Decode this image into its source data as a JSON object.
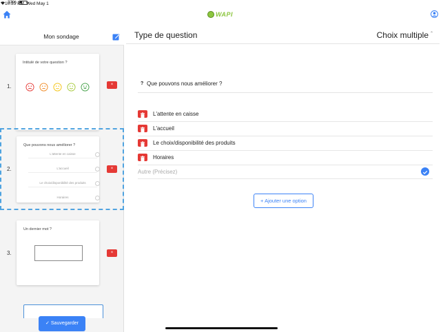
{
  "status_bar": {
    "time": "10:35 PM",
    "date": "Wed May 1",
    "battery_pct": "33%",
    "battery_fill": 0.33
  },
  "nav": {
    "logo_text": "WAPI"
  },
  "sidebar": {
    "title": "Mon sondage",
    "questions": [
      {
        "number": "1.",
        "label": "Intitulé de votre question ?",
        "type": "smiley"
      },
      {
        "number": "2.",
        "label": "Que pouvons nous améliorer ?",
        "type": "choice",
        "options": [
          "L'attente en caisse",
          "L'accueil",
          "Le choix/disponibilité des produits",
          "Horaires"
        ]
      },
      {
        "number": "3.",
        "label": "Un dernier mot ?",
        "type": "text"
      }
    ],
    "delete_label": "×",
    "save_label": "Sauvegarder"
  },
  "main": {
    "title": "Type de question",
    "type_value": "Choix multiple",
    "question_marker": "?",
    "question_text": "Que pouvons nous améliorer ?",
    "options": [
      "L'attente en caisse",
      "L'accueil",
      "Le choix/disponibilité des produits",
      "Horaires"
    ],
    "other_placeholder": "Autre (Précisez)",
    "add_option_label": "+ Ajouter une option"
  },
  "colors": {
    "accent": "#3b82f6",
    "danger": "#e53935",
    "dashed_selection": "#4fa3e0",
    "logo_green": "#8cc63f"
  },
  "icons": [
    "home-icon",
    "user-icon",
    "edit-icon",
    "trash-icon",
    "check-icon",
    "wifi-icon",
    "battery-icon"
  ]
}
